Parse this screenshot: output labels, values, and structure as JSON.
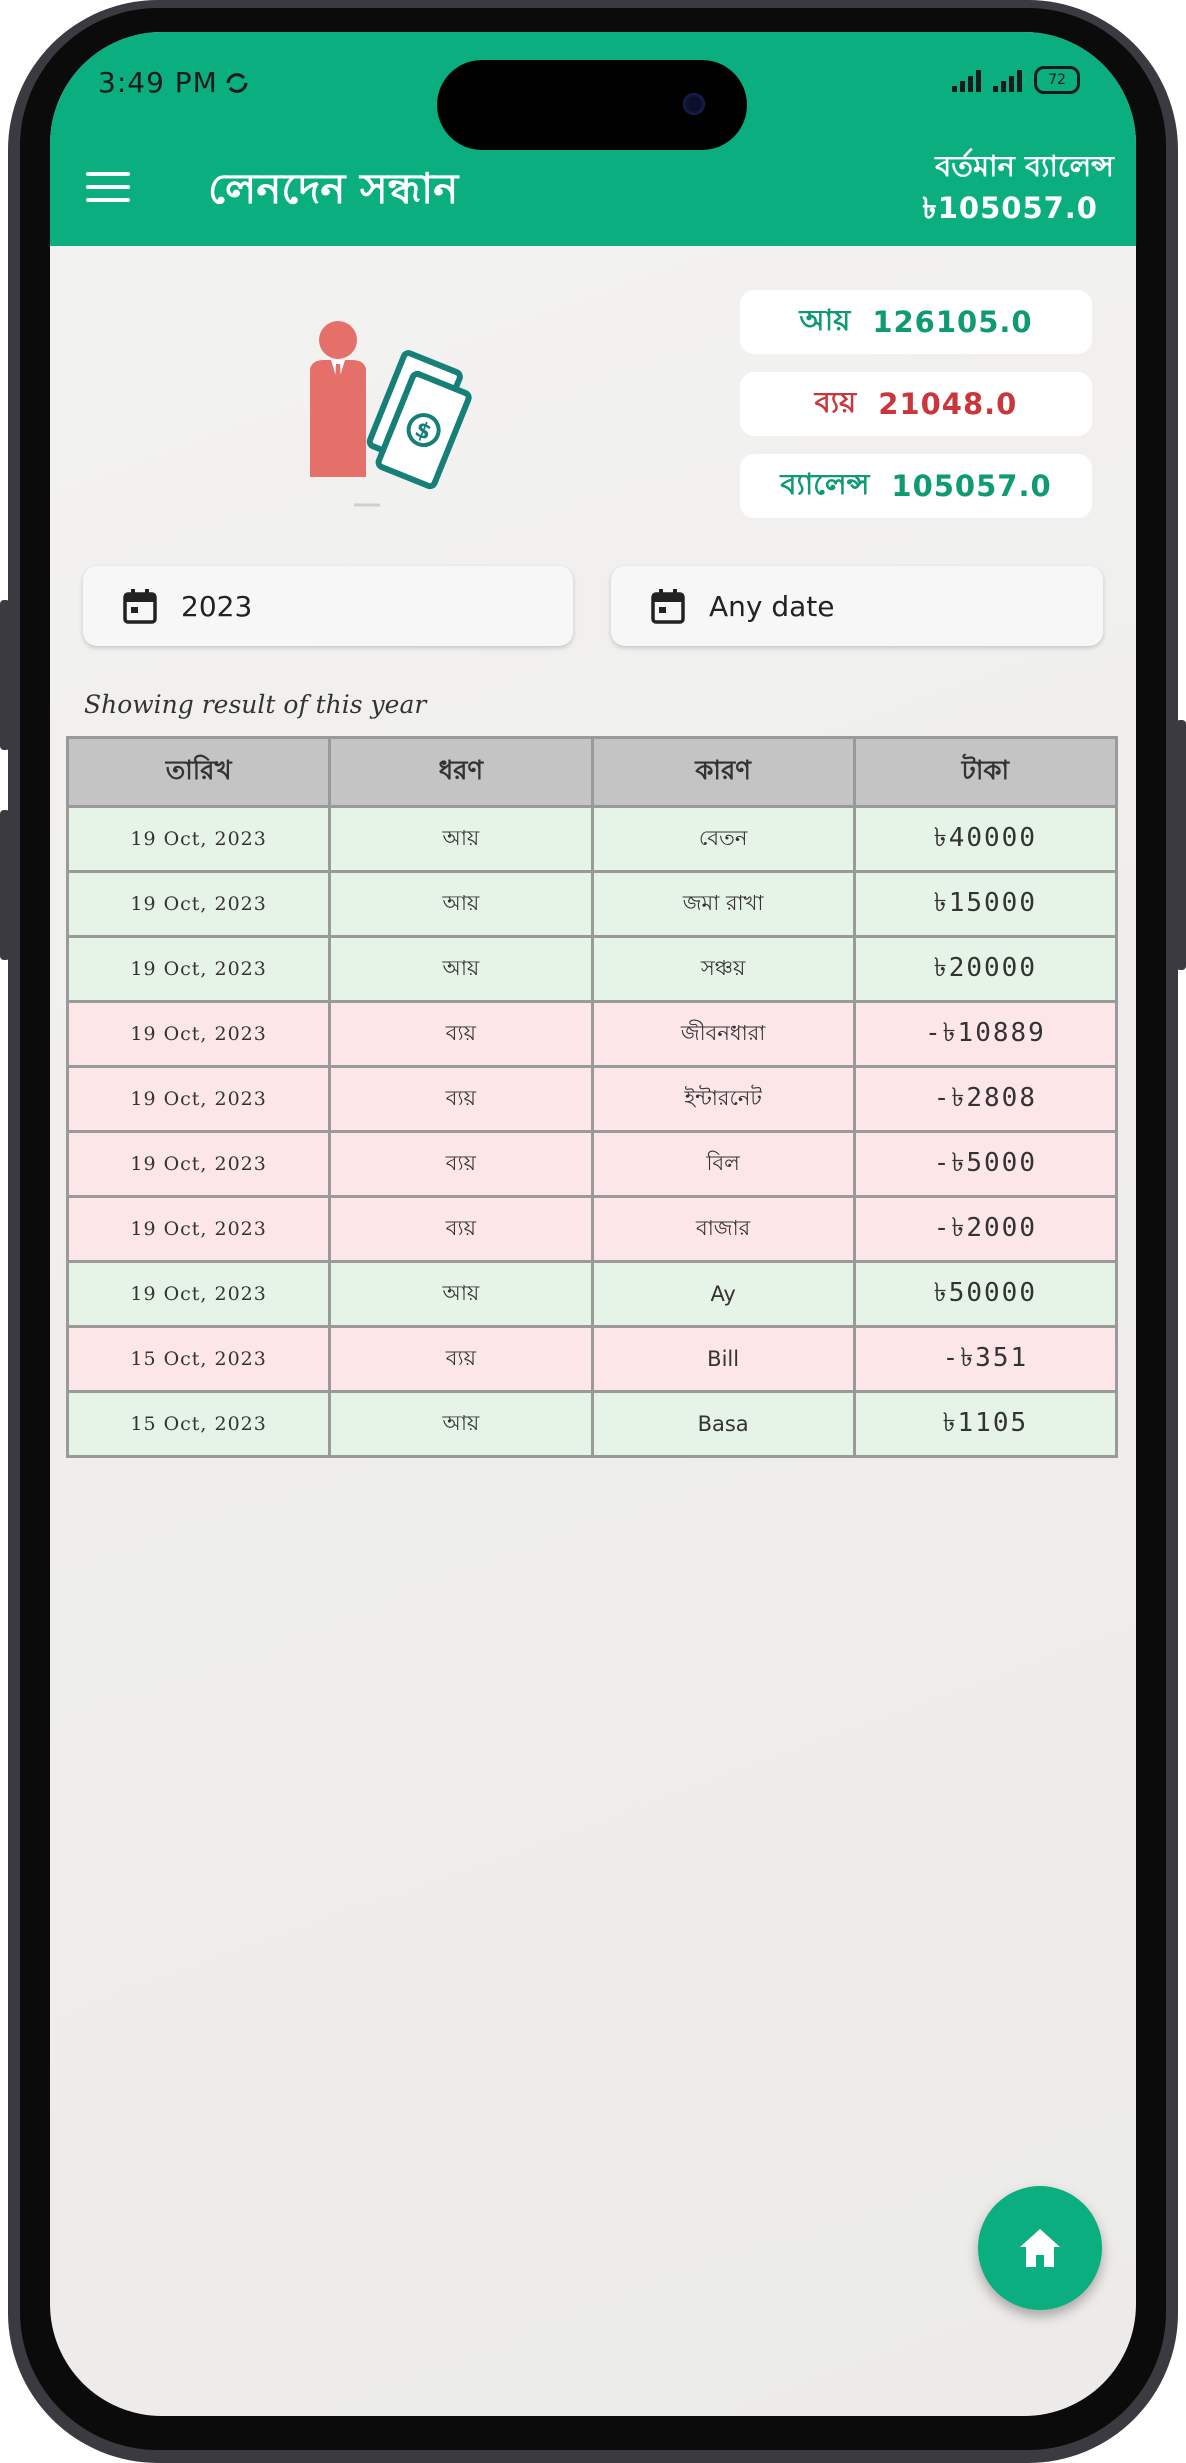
{
  "status_bar": {
    "time": "3:49 PM",
    "battery": "72"
  },
  "header": {
    "title": "লেনদেন সন্ধান",
    "balance_label": "বর্তমান ব্যালেন্স",
    "balance_value": "৳105057.0"
  },
  "summary": {
    "income_label": "আয়",
    "income_value": "126105.0",
    "expense_label": "ব্যয়",
    "expense_value": "21048.0",
    "balance_label": "ব্যালেন্স",
    "balance_value": "105057.0"
  },
  "filters": {
    "year": "2023",
    "date": "Any date"
  },
  "result_caption": "Showing result of this year",
  "table": {
    "columns": [
      "তারিখ",
      "ধরণ",
      "কারণ",
      "টাকা"
    ],
    "rows": [
      {
        "date": "19 Oct, 2023",
        "type": "আয়",
        "reason": "বেতন",
        "amount": "৳40000",
        "kind": "income"
      },
      {
        "date": "19 Oct, 2023",
        "type": "আয়",
        "reason": "জমা রাখা",
        "amount": "৳15000",
        "kind": "income"
      },
      {
        "date": "19 Oct, 2023",
        "type": "আয়",
        "reason": "সঞ্চয়",
        "amount": "৳20000",
        "kind": "income"
      },
      {
        "date": "19 Oct, 2023",
        "type": "ব্যয়",
        "reason": "জীবনধারা",
        "amount": "-৳10889",
        "kind": "expense"
      },
      {
        "date": "19 Oct, 2023",
        "type": "ব্যয়",
        "reason": "ইন্টারনেট",
        "amount": "-৳2808",
        "kind": "expense"
      },
      {
        "date": "19 Oct, 2023",
        "type": "ব্যয়",
        "reason": "বিল",
        "amount": "-৳5000",
        "kind": "expense"
      },
      {
        "date": "19 Oct, 2023",
        "type": "ব্যয়",
        "reason": "বাজার",
        "amount": "-৳2000",
        "kind": "expense"
      },
      {
        "date": "19 Oct, 2023",
        "type": "আয়",
        "reason": "Ay",
        "amount": "৳50000",
        "kind": "income"
      },
      {
        "date": "15 Oct, 2023",
        "type": "ব্যয়",
        "reason": "Bill",
        "amount": "-৳351",
        "kind": "expense"
      },
      {
        "date": "15 Oct, 2023",
        "type": "আয়",
        "reason": "Basa",
        "amount": "৳1105",
        "kind": "income"
      }
    ]
  },
  "icons": [
    "menu-icon",
    "calendar-icon",
    "home-icon",
    "businessman-money-icon",
    "signal-icon",
    "battery-icon",
    "sync-icon"
  ],
  "colors": {
    "primary": "#0aae7f",
    "income_text": "#0e9a73",
    "expense_text": "#c9363b",
    "income_row": "#e6f4e8",
    "expense_row": "#fde6e8"
  }
}
